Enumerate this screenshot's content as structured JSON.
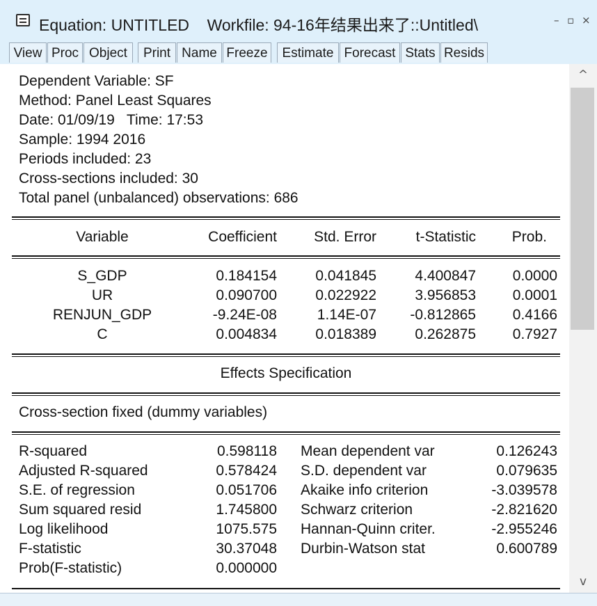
{
  "window": {
    "title": "Equation: UNTITLED    Workfile: 94-16年结果出来了::Untitled\\",
    "controls": {
      "minimize": "–",
      "restore": "▫",
      "close": "×"
    }
  },
  "toolbar": [
    "View",
    "Proc",
    "Object",
    "Print",
    "Name",
    "Freeze",
    "Estimate",
    "Forecast",
    "Stats",
    "Resids"
  ],
  "header_lines": [
    "Dependent Variable: SF",
    "Method: Panel Least Squares",
    "Date: 01/09/19   Time: 17:53",
    "Sample: 1994 2016",
    "Periods included: 23",
    "Cross-sections included: 30",
    "Total panel (unbalanced) observations: 686"
  ],
  "coef_table": {
    "columns": [
      "Variable",
      "Coefficient",
      "Std. Error",
      "t-Statistic",
      "Prob."
    ],
    "rows": [
      [
        "S_GDP",
        "0.184154",
        "0.041845",
        "4.400847",
        "0.0000"
      ],
      [
        "UR",
        "0.090700",
        "0.022922",
        "3.956853",
        "0.0001"
      ],
      [
        "RENJUN_GDP",
        "-9.24E-08",
        "1.14E-07",
        "-0.812865",
        "0.4166"
      ],
      [
        "C",
        "0.004834",
        "0.018389",
        "0.262875",
        "0.7927"
      ]
    ]
  },
  "effects": {
    "title": "Effects Specification",
    "spec": "Cross-section fixed (dummy variables)"
  },
  "stats_left": [
    [
      "R-squared",
      "0.598118"
    ],
    [
      "Adjusted R-squared",
      "0.578424"
    ],
    [
      "S.E. of regression",
      "0.051706"
    ],
    [
      "Sum squared resid",
      "1.745800"
    ],
    [
      "Log likelihood",
      "1075.575"
    ],
    [
      "F-statistic",
      "30.37048"
    ],
    [
      "Prob(F-statistic)",
      "0.000000"
    ]
  ],
  "stats_right": [
    [
      "Mean dependent var",
      "0.126243"
    ],
    [
      "S.D. dependent var",
      "0.079635"
    ],
    [
      "Akaike info criterion",
      "-3.039578"
    ],
    [
      "Schwarz criterion",
      "-2.821620"
    ],
    [
      "Hannan-Quinn criter.",
      "-2.955246"
    ],
    [
      "Durbin-Watson stat",
      "0.600789"
    ]
  ],
  "scrollbar": {
    "up": "^",
    "down": "v"
  }
}
